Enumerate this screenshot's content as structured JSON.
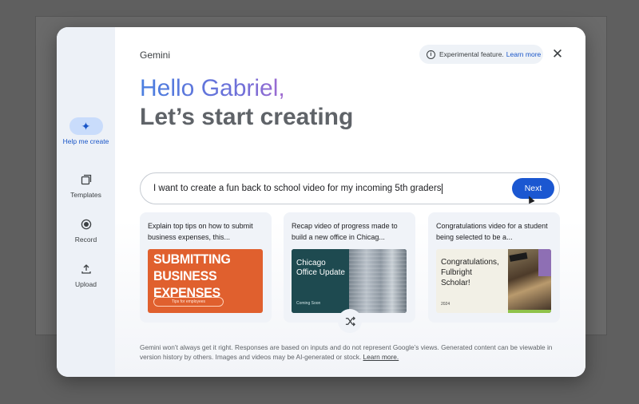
{
  "rail": {
    "items": [
      {
        "label": "Help me create",
        "icon": "sparkle-icon",
        "active": true
      },
      {
        "label": "Templates",
        "icon": "templates-icon"
      },
      {
        "label": "Record",
        "icon": "record-icon"
      },
      {
        "label": "Upload",
        "icon": "upload-icon"
      }
    ]
  },
  "header": {
    "brand": "Gemini",
    "notice": "Experimental feature.",
    "notice_link": "Learn more"
  },
  "greeting": {
    "line1": "Hello Gabriel,",
    "line2": "Let’s start creating"
  },
  "prompt": {
    "value": "I want to create a fun back to school video for my incoming 5th graders",
    "next_label": "Next"
  },
  "cards": [
    {
      "text": "Explain top tips on how to submit business expenses, this...",
      "thumb_title_1": "SUBMITTING",
      "thumb_title_2": "BUSINESS EXPENSES",
      "thumb_tag": "Tips for employees"
    },
    {
      "text": "Recap video of progress made to build a new office in Chicag...",
      "thumb_title_1": "Chicago",
      "thumb_title_2": "Office Update",
      "thumb_tag": "Coming Soon"
    },
    {
      "text": "Congratulations video for a student being selected to be a...",
      "thumb_title_1": "Congratulations,",
      "thumb_title_2": "Fulbright",
      "thumb_title_3": "Scholar!",
      "thumb_tag": "2024"
    }
  ],
  "disclaimer": {
    "text": "Gemini won’t always get it right. Responses are based on inputs and do not represent Google’s views. Generated content can be viewable in version history by others. Images and videos may be AI-generated or stock. ",
    "link": "Learn more."
  },
  "colors": {
    "accent": "#1b57d1",
    "rail_bg": "#edf1f7",
    "card_bg": "#f0f3f8"
  }
}
